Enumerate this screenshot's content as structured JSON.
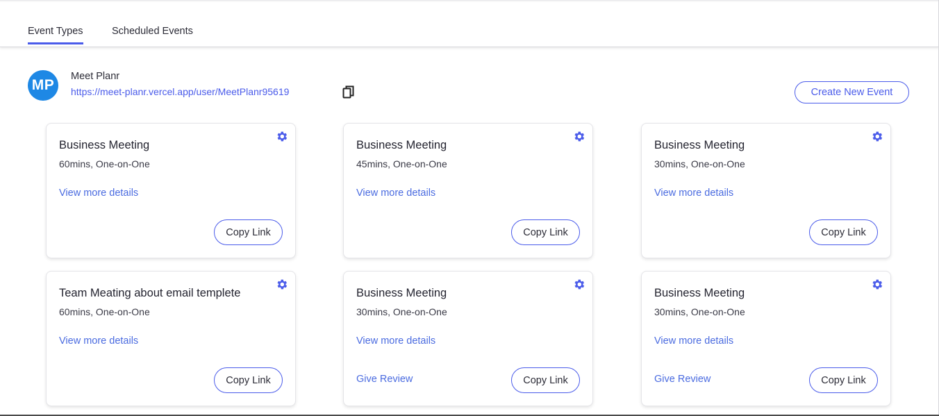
{
  "tabs": [
    {
      "label": "Event Types",
      "active": true
    },
    {
      "label": "Scheduled Events",
      "active": false
    }
  ],
  "user": {
    "initials": "MP",
    "name": "Meet Planr",
    "link": "https://meet-planr.vercel.app/user/MeetPlanr95619"
  },
  "create_button": "Create New Event",
  "colors": {
    "accent": "#4a5bea",
    "avatar": "#1e88e5",
    "link": "#4a6be0"
  },
  "icons": {
    "copy": "copy-icon",
    "settings": "gear-icon"
  },
  "events": [
    {
      "title": "Business Meeting",
      "meta": "60mins, One-on-One",
      "details": "View more details",
      "copy": "Copy Link"
    },
    {
      "title": "Business Meeting",
      "meta": "45mins, One-on-One",
      "details": "View more details",
      "copy": "Copy Link"
    },
    {
      "title": "Business Meeting",
      "meta": "30mins, One-on-One",
      "details": "View more details",
      "copy": "Copy Link"
    },
    {
      "title": "Team Meating about email templete",
      "meta": "60mins, One-on-One",
      "details": "View more details",
      "copy": "Copy Link"
    },
    {
      "title": "Business Meeting",
      "meta": "30mins, One-on-One",
      "details": "View more details",
      "review": "Give Review",
      "copy": "Copy Link"
    },
    {
      "title": "Business Meeting",
      "meta": "30mins, One-on-One",
      "details": "View more details",
      "review": "Give Review",
      "copy": "Copy Link"
    }
  ]
}
